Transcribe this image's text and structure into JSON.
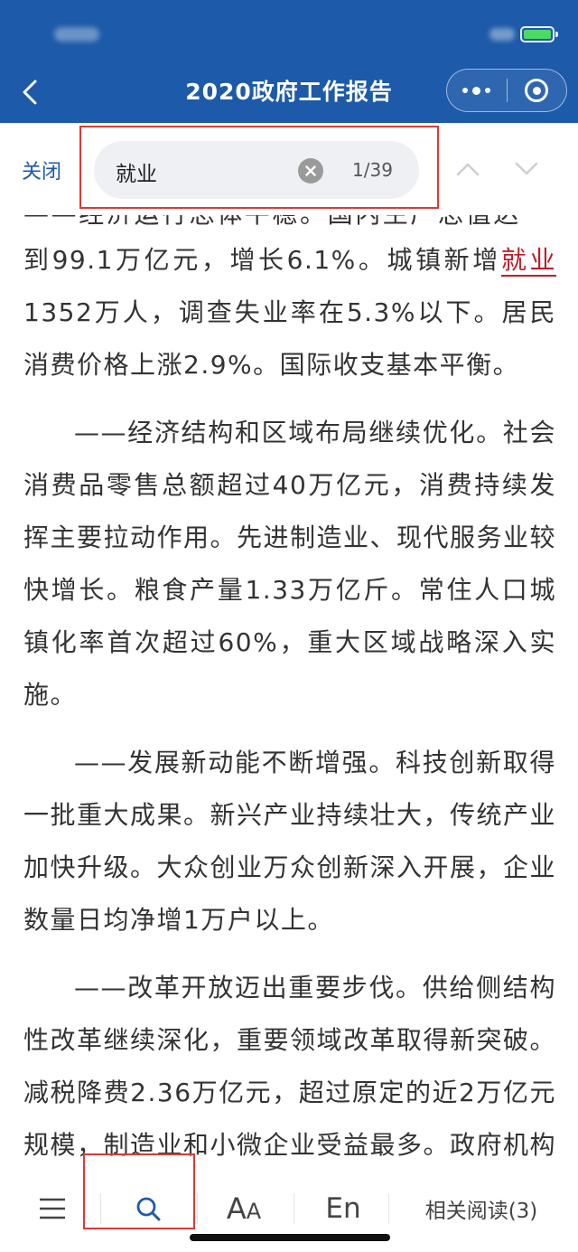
{
  "header": {
    "title": "2020政府工作报告"
  },
  "search": {
    "close_label": "关闭",
    "query": "就业",
    "match_count": "1/39"
  },
  "article": {
    "cut_line": "——经济运行总体平稳。国内生产总值达",
    "p1_before": "到99.1万亿元，增长6.1%。城镇新增",
    "p1_hl": "就业",
    "p1_after": "1352万人，调查失业率在5.3%以下。居民消费价格上涨2.9%。国际收支基本平衡。",
    "p2": "——经济结构和区域布局继续优化。社会消费品零售总额超过40万亿元，消费持续发挥主要拉动作用。先进制造业、现代服务业较快增长。粮食产量1.33万亿斤。常住人口城镇化率首次超过60%，重大区域战略深入实施。",
    "p3": "——发展新动能不断增强。科技创新取得一批重大成果。新兴产业持续壮大，传统产业加快升级。大众创业万众创新深入开展，企业数量日均净增1万户以上。",
    "p4": "——改革开放迈出重要步伐。供给侧结构性改革继续深化，重要领域改革取得新突破。减税降费2.36万亿元，超过原定的近2万亿元规模，制造业和小微企业受益最多。政府机构改革任务完成。“放管服”改革纵深推进。设立"
  },
  "toolbar": {
    "font_label_big": "A",
    "font_label_small": "A",
    "en_label": "En",
    "related_label": "相关阅读(3)"
  },
  "colors": {
    "header_bg": "#1d5aa9",
    "highlight": "#b8202a",
    "annotation_box": "#d93a3a"
  }
}
